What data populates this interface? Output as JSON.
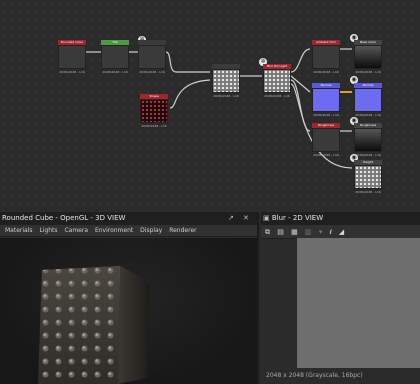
{
  "graph": {
    "nodes": [
      {
        "id": "n1",
        "header": "Rounded Cube",
        "header_color": "#a0262e",
        "thumb": "dark",
        "caption": "2048x2048 - L16"
      },
      {
        "id": "n2",
        "header": "Tile",
        "header_color": "#4f9a47",
        "thumb": "dark",
        "caption": "2048x2048 - L16"
      },
      {
        "id": "n3",
        "header": "",
        "header_color": "#3a3a3a",
        "thumb": "dark",
        "caption": "2048x2048 - L16"
      },
      {
        "id": "n4",
        "header": "",
        "header_color": "#3a3a3a",
        "thumb": "check",
        "caption": "2048x2048 - L16"
      },
      {
        "id": "n5",
        "header": "Shape",
        "header_color": "#a0262e",
        "thumb": "red",
        "caption": "2048x2048 - L16"
      },
      {
        "id": "n6",
        "header": "Blur HQ Light",
        "header_color": "#a0262e",
        "thumb": "check",
        "caption": "2048x2048 - L16"
      },
      {
        "id": "n7",
        "header": "Ambient Occl",
        "header_color": "#a0262e",
        "thumb": "dark",
        "caption": "2048x2048 - L16"
      },
      {
        "id": "n8",
        "header": "Base Color",
        "header_color": "#444",
        "thumb": "blackgrad",
        "caption": "2048x2048 - L16"
      },
      {
        "id": "n9",
        "header": "Normal",
        "header_color": "#5a5ad8",
        "thumb": "blue",
        "caption": "2048x2048 - L16"
      },
      {
        "id": "n10",
        "header": "Normal",
        "header_color": "#5a5ad8",
        "thumb": "blue",
        "caption": "2048x2048 - L16"
      },
      {
        "id": "n11",
        "header": "Roughness",
        "header_color": "#a0262e",
        "thumb": "dark",
        "caption": "2048x2048 - L16"
      },
      {
        "id": "n12",
        "header": "Roughness",
        "header_color": "#444",
        "thumb": "blackgrad",
        "caption": "2048x2048 - L16"
      },
      {
        "id": "n13",
        "header": "Height",
        "header_color": "#444",
        "thumb": "check",
        "caption": "2048x2048 - L16"
      }
    ]
  },
  "panel3d": {
    "title": "Rounded Cube - OpenGL - 3D VIEW",
    "pin_icon": "↗",
    "close_icon": "✕",
    "menu": [
      "Materials",
      "Lights",
      "Camera",
      "Environment",
      "Display",
      "Renderer"
    ]
  },
  "panel2d": {
    "title": "Blur - 2D VIEW",
    "status": "2048 x 2048 (Grayscale, 16bpc)"
  },
  "colors": {
    "wire": "#d0d0d0",
    "wire_orange": "#e79a2a",
    "accent_blue": "#6c6cf2"
  }
}
